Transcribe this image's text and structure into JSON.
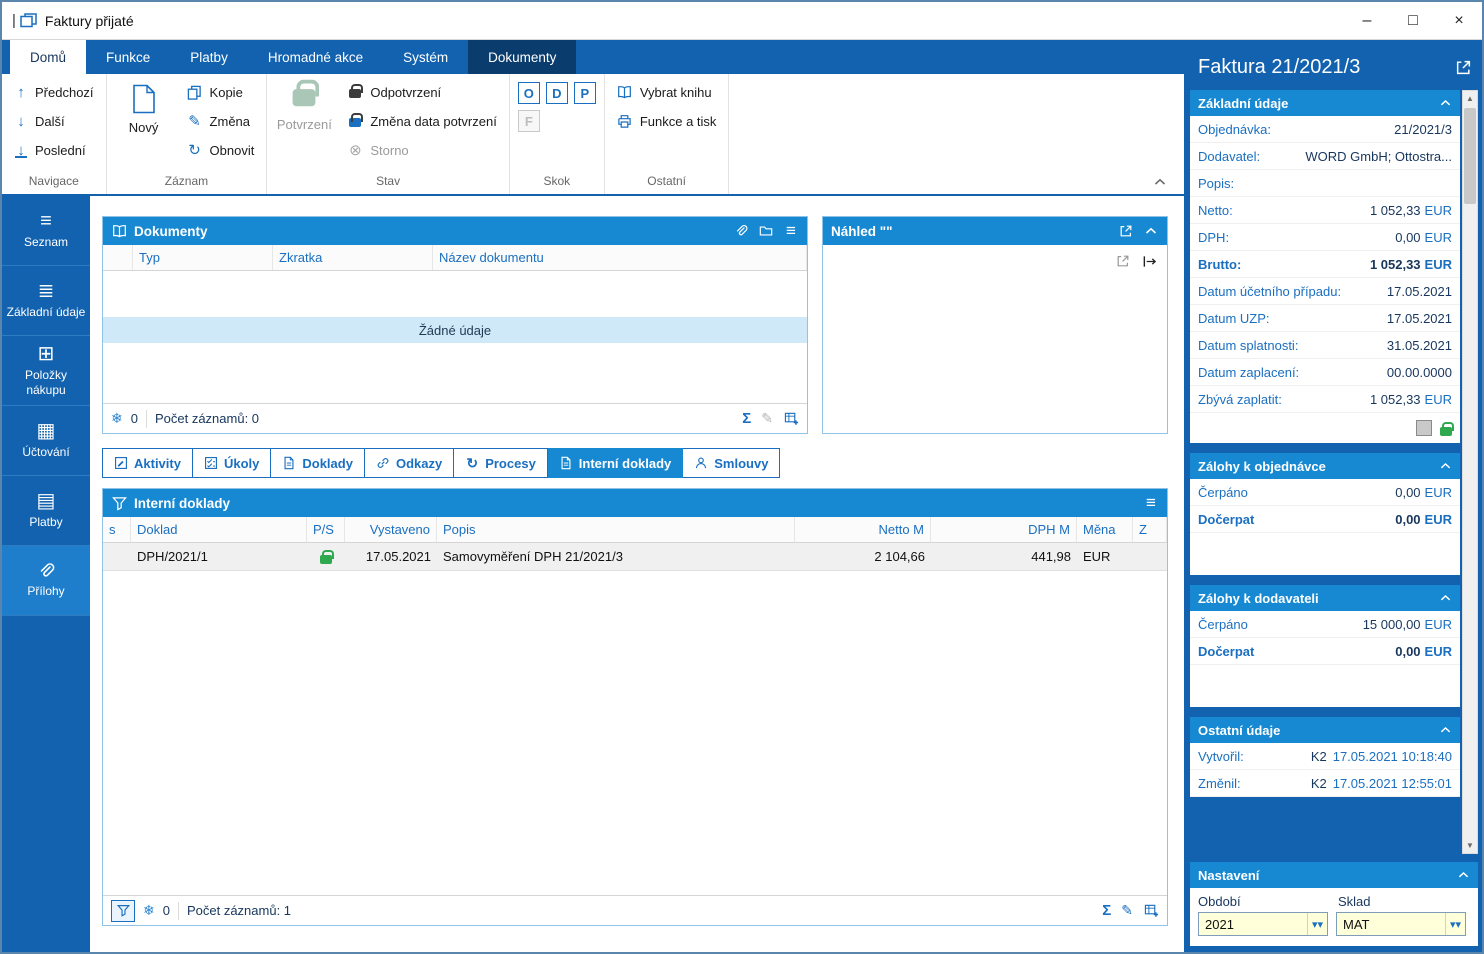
{
  "window": {
    "title": "Faktury přijaté"
  },
  "ribbon": {
    "tabs": [
      "Domů",
      "Funkce",
      "Platby",
      "Hromadné akce",
      "Systém",
      "Dokumenty"
    ],
    "navigace": {
      "label": "Navigace",
      "prev": "Předchozí",
      "next": "Další",
      "last": "Poslední"
    },
    "zaznam": {
      "label": "Záznam",
      "new": "Nový",
      "copy": "Kopie",
      "change": "Změna",
      "refresh": "Obnovit"
    },
    "stav": {
      "label": "Stav",
      "confirm": "Potvrzení",
      "unconfirm": "Odpotvrzení",
      "change_date": "Změna data potvrzení",
      "storno": "Storno"
    },
    "skok": {
      "label": "Skok",
      "o": "O",
      "d": "D",
      "p": "P",
      "f": "F"
    },
    "ostatni": {
      "label": "Ostatní",
      "select_book": "Vybrat knihu",
      "func_print": "Funkce a tisk"
    }
  },
  "sidebar": {
    "items": [
      {
        "label": "Seznam"
      },
      {
        "label": "Základní údaje"
      },
      {
        "label": "Položky nákupu"
      },
      {
        "label": "Účtování"
      },
      {
        "label": "Platby"
      },
      {
        "label": "Přílohy"
      }
    ]
  },
  "documents_panel": {
    "title": "Dokumenty",
    "columns": [
      "Typ",
      "Zkratka",
      "Název dokumentu"
    ],
    "empty_text": "Žádné údaje",
    "badge": "0",
    "count_label": "Počet záznamů: 0"
  },
  "preview_panel": {
    "title": "Náhled \"\""
  },
  "detail_tabs": [
    {
      "label": "Aktivity"
    },
    {
      "label": "Úkoly"
    },
    {
      "label": "Doklady"
    },
    {
      "label": "Odkazy"
    },
    {
      "label": "Procesy"
    },
    {
      "label": "Interní doklady"
    },
    {
      "label": "Smlouvy"
    }
  ],
  "internal_docs": {
    "title": "Interní doklady",
    "columns": [
      "s",
      "Doklad",
      "P/S",
      "Vystaveno",
      "Popis",
      "Netto M",
      "DPH M",
      "Měna",
      "Z"
    ],
    "rows": [
      {
        "doklad": "DPH/2021/1",
        "vystaveno": "17.05.2021",
        "popis": "Samovyměření DPH 21/2021/3",
        "netto": "2 104,66",
        "dph": "441,98",
        "mena": "EUR"
      }
    ],
    "badge": "0",
    "count_label": "Počet záznamů: 1"
  },
  "invoice_panel": {
    "title": "Faktura 21/2021/3",
    "basic": {
      "title": "Základní údaje",
      "rows": [
        {
          "label": "Objednávka:",
          "value": "21/2021/3"
        },
        {
          "label": "Dodavatel:",
          "value": "WORD GmbH; Ottostra..."
        },
        {
          "label": "Popis:",
          "value": ""
        },
        {
          "label": "Netto:",
          "value": "1 052,33",
          "unit": "EUR"
        },
        {
          "label": "DPH:",
          "value": "0,00",
          "unit": "EUR"
        },
        {
          "label": "Brutto:",
          "value": "1 052,33",
          "unit": "EUR"
        },
        {
          "label": "Datum účetního případu:",
          "value": "17.05.2021"
        },
        {
          "label": "Datum UZP:",
          "value": "17.05.2021"
        },
        {
          "label": "Datum splatnosti:",
          "value": "31.05.2021"
        },
        {
          "label": "Datum zaplacení:",
          "value": "00.00.0000"
        },
        {
          "label": "Zbývá zaplatit:",
          "value": "1 052,33",
          "unit": "EUR"
        }
      ]
    },
    "advances_order": {
      "title": "Zálohy k objednávce",
      "rows": [
        {
          "label": "Čerpáno",
          "value": "0,00",
          "unit": "EUR"
        },
        {
          "label": "Dočerpat",
          "value": "0,00",
          "unit": "EUR"
        }
      ]
    },
    "advances_supplier": {
      "title": "Zálohy k dodavateli",
      "rows": [
        {
          "label": "Čerpáno",
          "value": "15 000,00",
          "unit": "EUR"
        },
        {
          "label": "Dočerpat",
          "value": "0,00",
          "unit": "EUR"
        }
      ]
    },
    "other": {
      "title": "Ostatní údaje",
      "rows": [
        {
          "label": "Vytvořil:",
          "user": "K2",
          "datetime": "17.05.2021 10:18:40"
        },
        {
          "label": "Změnil:",
          "user": "K2",
          "datetime": "17.05.2021 12:55:01"
        }
      ]
    },
    "settings": {
      "title": "Nastavení",
      "fields": [
        {
          "label": "Období",
          "value": "2021"
        },
        {
          "label": "Sklad",
          "value": "MAT"
        }
      ]
    }
  }
}
